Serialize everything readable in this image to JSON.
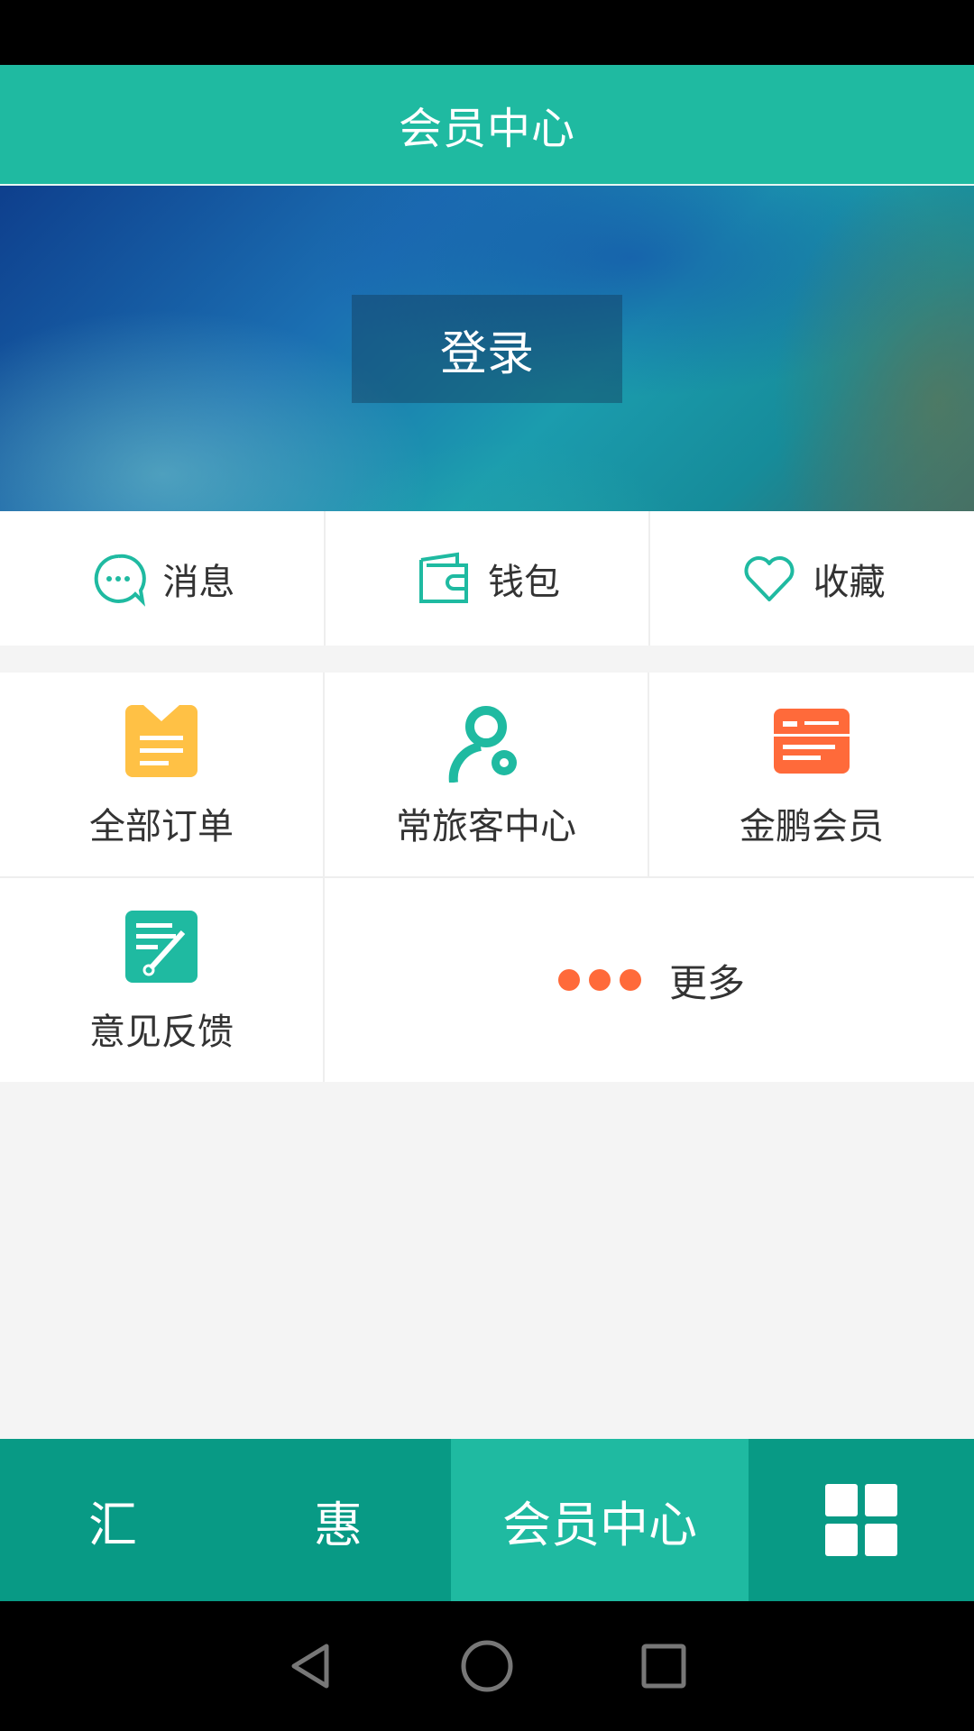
{
  "header": {
    "title": "会员中心"
  },
  "banner": {
    "login_label": "登录"
  },
  "quick_actions": [
    {
      "label": "消息",
      "icon": "message-icon"
    },
    {
      "label": "钱包",
      "icon": "wallet-icon"
    },
    {
      "label": "收藏",
      "icon": "heart-icon"
    }
  ],
  "grid": [
    {
      "label": "全部订单",
      "icon": "orders-icon"
    },
    {
      "label": "常旅客中心",
      "icon": "frequent-flyer-icon"
    },
    {
      "label": "金鹏会员",
      "icon": "member-card-icon"
    },
    {
      "label": "意见反馈",
      "icon": "feedback-icon"
    }
  ],
  "more": {
    "label": "更多"
  },
  "tabs": [
    {
      "label": "汇"
    },
    {
      "label": "惠"
    },
    {
      "label": "会员中心",
      "active": true
    },
    {
      "label": "",
      "icon": "apps-grid-icon"
    }
  ],
  "colors": {
    "primary": "#1fbaa1",
    "tab_bar": "#089a85",
    "accent_orange": "#ff6a3a",
    "accent_yellow": "#ffc145"
  }
}
